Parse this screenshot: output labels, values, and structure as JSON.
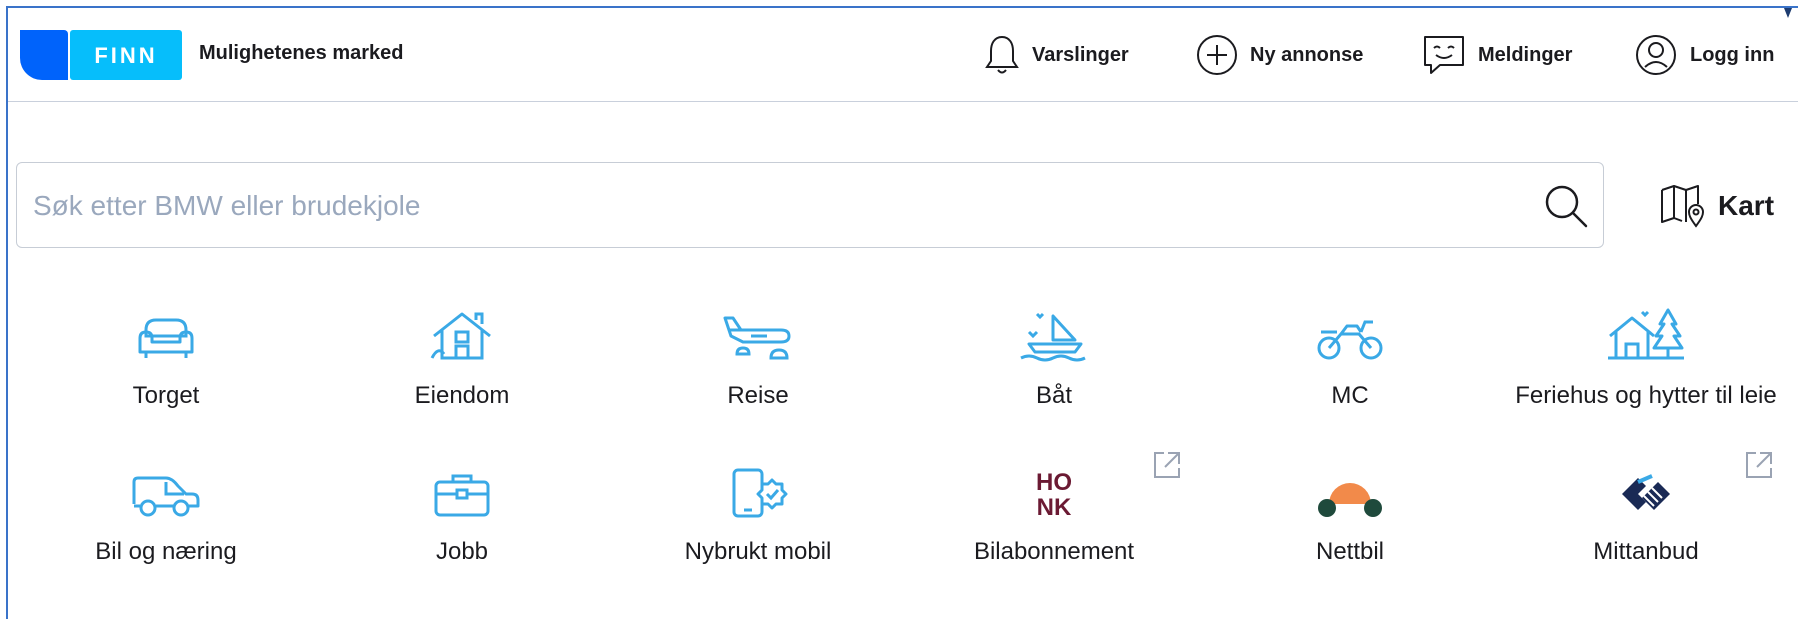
{
  "header": {
    "logo_text": "FINN",
    "tagline": "Mulighetenes marked",
    "nav": [
      {
        "label": "Varslinger",
        "icon": "bell-icon"
      },
      {
        "label": "Ny annonse",
        "icon": "plus-circle-icon"
      },
      {
        "label": "Meldinger",
        "icon": "chat-bubble-icon"
      },
      {
        "label": "Logg inn",
        "icon": "user-circle-icon"
      }
    ]
  },
  "search": {
    "placeholder": "Søk etter BMW eller brudekjole",
    "value": ""
  },
  "map": {
    "label": "Kart",
    "icon": "map-pin-icon"
  },
  "categories": [
    {
      "label": "Torget",
      "icon": "sofa-icon"
    },
    {
      "label": "Eiendom",
      "icon": "house-icon"
    },
    {
      "label": "Reise",
      "icon": "airplane-icon"
    },
    {
      "label": "Båt",
      "icon": "boat-icon"
    },
    {
      "label": "MC",
      "icon": "motorcycle-icon"
    },
    {
      "label": "Feriehus og hytter til leie",
      "icon": "cabin-icon"
    },
    {
      "label": "Bil og næring",
      "icon": "car-icon"
    },
    {
      "label": "Jobb",
      "icon": "briefcase-icon"
    },
    {
      "label": "Nybrukt mobil",
      "icon": "mobile-icon"
    },
    {
      "label": "Bilabonnement",
      "icon": "honk-logo-icon",
      "logo_text": "HONK",
      "external": true
    },
    {
      "label": "Nettbil",
      "icon": "nettbil-logo-icon"
    },
    {
      "label": "Mittanbud",
      "icon": "mittanbud-logo-icon",
      "external": true
    }
  ],
  "colors": {
    "brand_blue": "#0063fb",
    "brand_cyan": "#06befb",
    "icon_blue": "#3aa9e6",
    "honk": "#6b1a33",
    "nettbil_orange": "#f28a4a",
    "nettbil_green": "#1f4a3c",
    "mittanbud_navy": "#1a2a55"
  }
}
